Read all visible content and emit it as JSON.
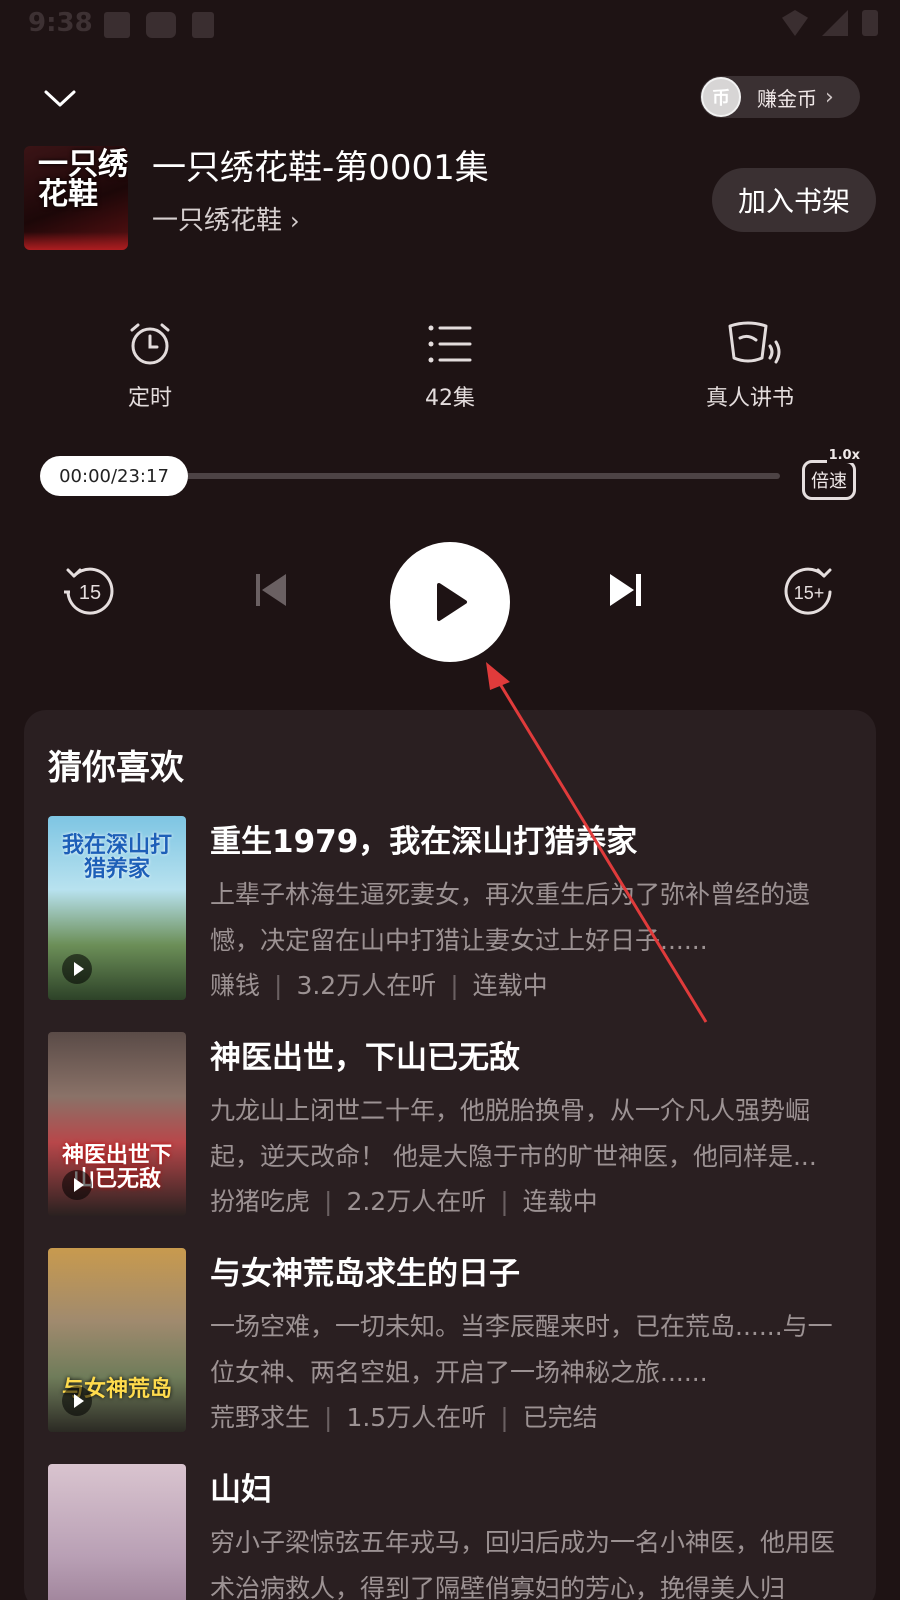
{
  "status_bar": {
    "time": "9:38"
  },
  "header": {
    "coin_label": "赚金币",
    "coin_icon_glyph": "币",
    "episode_title": "一只绣花鞋-第0001集",
    "book_name": "一只绣花鞋",
    "add_shelf_label": "加入书架",
    "cover_text": "一只绣花鞋"
  },
  "functions": [
    {
      "label": "定时",
      "icon": "alarm-clock-icon"
    },
    {
      "label": "42集",
      "icon": "list-icon"
    },
    {
      "label": "真人讲书",
      "icon": "cup-sound-icon"
    }
  ],
  "player": {
    "time_display": "00:00/23:17",
    "progress": 0,
    "speed_label": "倍速",
    "speed_value": "1.0x",
    "rewind_label": "15",
    "forward_label": "15+"
  },
  "recommend": {
    "title": "猜你喜欢",
    "items": [
      {
        "name": "重生1979，我在深山打猎养家",
        "desc": "上辈子林海生逼死妻女，再次重生后为了弥补曾经的遗憾，决定留在山中打猎让妻女过上好日子......",
        "author": "赚钱",
        "listeners": "3.2万人在听",
        "status": "连载中",
        "cover_text": "我在深山打猎养家"
      },
      {
        "name": "神医出世，下山已无敌",
        "desc": "九龙山上闭世二十年，他脱胎换骨，从一介凡人强势崛起，逆天改命！ 他是大隐于市的旷世神医，他同样是...",
        "author": "扮猪吃虎",
        "listeners": "2.2万人在听",
        "status": "连载中",
        "cover_text": "神医出世下山已无敌"
      },
      {
        "name": "与女神荒岛求生的日子",
        "desc": "一场空难，一切未知。当李辰醒来时，已在荒岛......与一位女神、两名空姐，开启了一场神秘之旅......",
        "author": "荒野求生",
        "listeners": "1.5万人在听",
        "status": "已完结",
        "cover_text": "与女神荒岛"
      },
      {
        "name": "山妇",
        "desc": "穷小子梁惊弦五年戎马，回归后成为一名小神医，他用医术治病救人，得到了隔壁俏寡妇的芳心，挽得美人归",
        "author": "",
        "listeners": "",
        "status": "",
        "cover_text": ""
      }
    ]
  },
  "colors": {
    "background": "#1e1314",
    "card": "#2a1f21",
    "annotation_arrow": "#e03b3b"
  }
}
